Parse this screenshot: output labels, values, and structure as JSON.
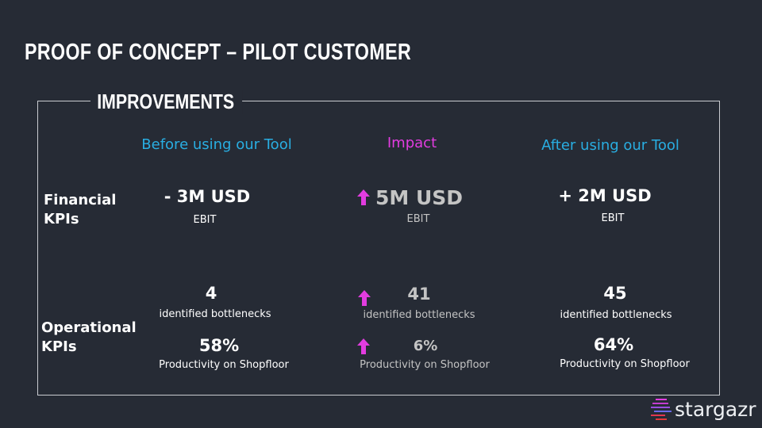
{
  "title": "PROOF OF CONCEPT – PILOT CUSTOMER",
  "section_title": "IMPROVEMENTS",
  "colors": {
    "background": "#262b35",
    "accent_blue": "#29aee2",
    "accent_magenta": "#e23ce0",
    "frame": "#c9ccd1"
  },
  "columns": {
    "before": "Before using our Tool",
    "impact": "Impact",
    "after": "After using our Tool"
  },
  "rows": {
    "financial": [
      "Financial",
      "KPIs"
    ],
    "operational": [
      "Operational",
      "KPIs"
    ]
  },
  "financial": {
    "before": {
      "value": "- 3M USD",
      "label": "EBIT"
    },
    "impact": {
      "value": "5M USD",
      "label": "EBIT"
    },
    "after": {
      "value": "+ 2M USD",
      "label": "EBIT"
    }
  },
  "bottlenecks": {
    "before": {
      "value": "4",
      "label": "identified bottlenecks"
    },
    "impact": {
      "value": "41",
      "label": "identified bottlenecks"
    },
    "after": {
      "value": "45",
      "label": "identified bottlenecks"
    }
  },
  "productivity": {
    "before": {
      "value": "58%",
      "label": "Productivity on Shopfloor"
    },
    "impact": {
      "value": "6%",
      "label": "Productivity on Shopfloor"
    },
    "after": {
      "value": "64%",
      "label": "Productivity on Shopfloor"
    }
  },
  "icons": {
    "impact_arrow": "arrow-up-icon",
    "logo": "stargazr-logo-icon"
  },
  "brand": "stargazr"
}
